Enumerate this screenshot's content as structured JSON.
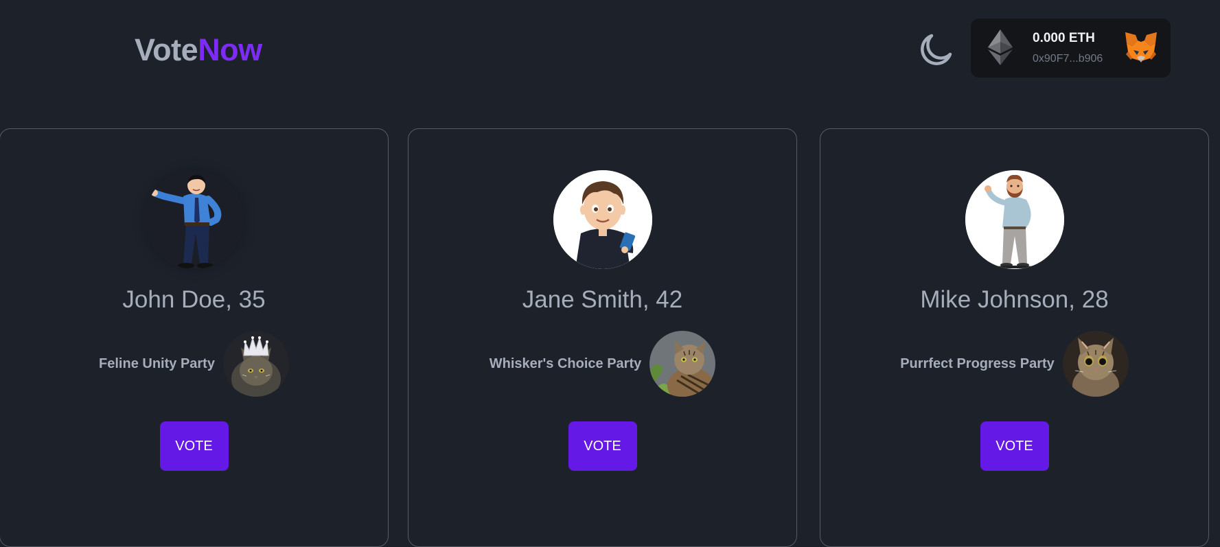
{
  "header": {
    "logo_part1": "Vote",
    "logo_part2": "Now",
    "theme_toggle_icon": "moon-icon",
    "wallet": {
      "balance": "0.000 ETH",
      "address": "0x90F7...b906",
      "network_icon": "ethereum-icon",
      "provider_icon": "metamask-fox-icon"
    }
  },
  "colors": {
    "background": "#1d212a",
    "accent": "#7c2cf5",
    "button": "#6419e6",
    "text": "#a6adbb"
  },
  "candidates": [
    {
      "name_age": "John Doe, 35",
      "avatar_icon": "man-presenting-avatar",
      "party": "Feline Unity Party",
      "party_logo": "crowned-cat-image",
      "button_label": "VOTE"
    },
    {
      "name_age": "Jane Smith, 42",
      "avatar_icon": "man-with-phone-avatar",
      "party": "Whisker's Choice Party",
      "party_logo": "tabby-cat-image",
      "button_label": "VOTE"
    },
    {
      "name_age": "Mike Johnson, 28",
      "avatar_icon": "bearded-man-waving-avatar",
      "party": "Purrfect Progress Party",
      "party_logo": "surprised-cat-image",
      "button_label": "VOTE"
    }
  ]
}
